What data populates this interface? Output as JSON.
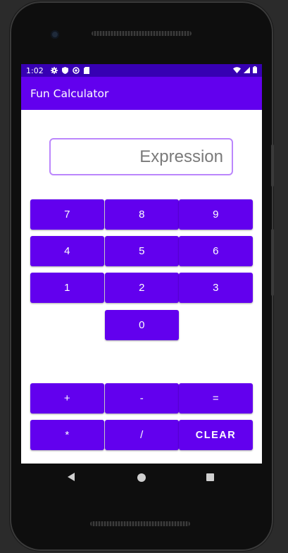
{
  "status_bar": {
    "time": "1:02"
  },
  "app": {
    "title": "Fun Calculator",
    "brand_color": "#6200ee",
    "status_color": "#3700b3",
    "field_border_color": "#bb86fc"
  },
  "expression": {
    "value": "",
    "placeholder": "Expression"
  },
  "keys": {
    "seven": "7",
    "eight": "8",
    "nine": "9",
    "four": "4",
    "five": "5",
    "six": "6",
    "one": "1",
    "two": "2",
    "three": "3",
    "zero": "0",
    "plus": "+",
    "minus": "-",
    "equals": "=",
    "multiply": "*",
    "divide": "/",
    "clear": "CLEAR"
  },
  "icons": {
    "status": [
      "settings-icon",
      "shield-icon",
      "data-saver-icon",
      "sd-card-icon"
    ],
    "status_right": [
      "wifi-icon",
      "signal-icon",
      "battery-icon"
    ],
    "nav": [
      "back-icon",
      "home-icon",
      "recents-icon"
    ]
  }
}
